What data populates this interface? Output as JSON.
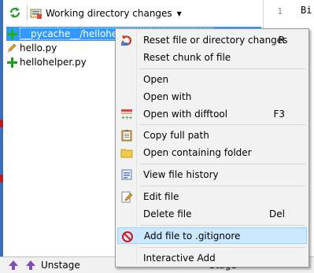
{
  "toolbar": {
    "dropdown_label": "Working directory changes"
  },
  "files": [
    {
      "name": "__pycache__/hellohelper.cpython-37.pyc",
      "status": "added"
    },
    {
      "name": "hello.py",
      "status": "modified"
    },
    {
      "name": "hellohelper.py",
      "status": "added"
    }
  ],
  "gutter": {
    "line_number": "1"
  },
  "diff": {
    "text": "Bi"
  },
  "bottom": {
    "unstage_label": "Unstage",
    "stage_label": "Stage"
  },
  "menu": {
    "items": [
      {
        "label": "Reset file or directory changes",
        "shortcut": "R",
        "icon": "reset-icon"
      },
      {
        "label": "Reset chunk of file",
        "shortcut": "",
        "icon": ""
      },
      {
        "label": "Open",
        "shortcut": "",
        "icon": ""
      },
      {
        "label": "Open with",
        "shortcut": "",
        "icon": ""
      },
      {
        "label": "Open with difftool",
        "shortcut": "F3",
        "icon": "difftool-icon"
      },
      {
        "label": "Copy full path",
        "shortcut": "",
        "icon": "clipboard-icon"
      },
      {
        "label": "Open containing folder",
        "shortcut": "",
        "icon": "folder-icon"
      },
      {
        "label": "View file history",
        "shortcut": "",
        "icon": "history-icon"
      },
      {
        "label": "Edit file",
        "shortcut": "",
        "icon": "edit-icon"
      },
      {
        "label": "Delete file",
        "shortcut": "Del",
        "icon": ""
      },
      {
        "label": "Add file to .gitignore",
        "shortcut": "",
        "icon": "ignore-icon"
      },
      {
        "label": "Interactive Add",
        "shortcut": "",
        "icon": ""
      }
    ]
  },
  "colors": {
    "selection": "#3399ff",
    "added": "#17a317",
    "menu_highlight": "#cce8ff"
  }
}
